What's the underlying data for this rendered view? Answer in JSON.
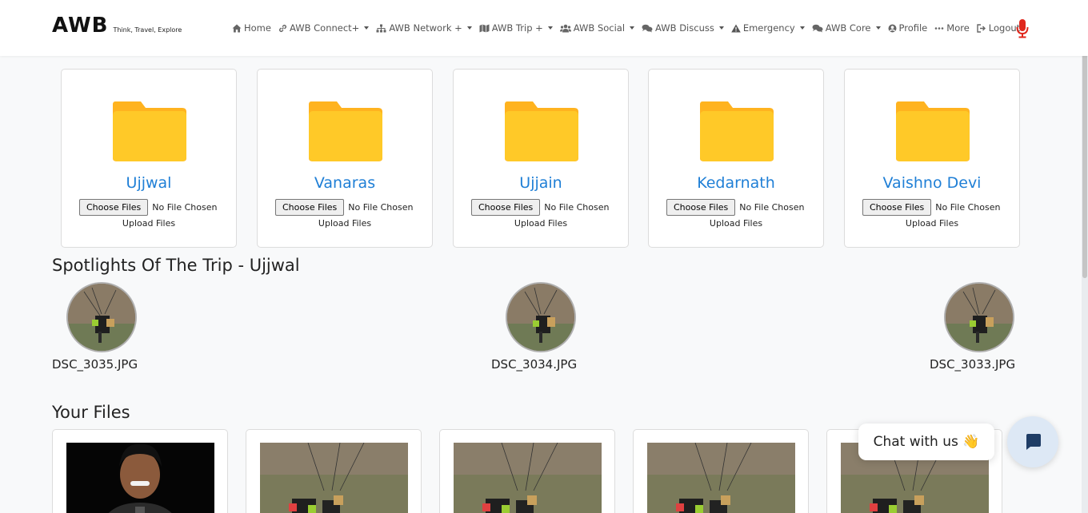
{
  "brand": {
    "name": "AWB",
    "tagline": "Think, Travel, Explore"
  },
  "nav": [
    {
      "label": "Home",
      "icon": "home-icon",
      "dropdown": false
    },
    {
      "label": "AWB Connect+",
      "icon": "link-icon",
      "dropdown": true
    },
    {
      "label": "AWB Network +",
      "icon": "sitemap-icon",
      "dropdown": true
    },
    {
      "label": "AWB Trip +",
      "icon": "map-icon",
      "dropdown": true
    },
    {
      "label": "AWB Social",
      "icon": "users-icon",
      "dropdown": true
    },
    {
      "label": "AWB Discuss",
      "icon": "comments-icon",
      "dropdown": true
    },
    {
      "label": "Emergency",
      "icon": "warning-icon",
      "dropdown": true
    },
    {
      "label": "AWB Core",
      "icon": "comments-icon",
      "dropdown": true
    },
    {
      "label": "Profile",
      "icon": "user-circle-icon",
      "dropdown": false
    },
    {
      "label": "More",
      "icon": "ellipsis-icon",
      "dropdown": false
    },
    {
      "label": "Logout",
      "icon": "logout-icon",
      "dropdown": false
    }
  ],
  "folders": [
    {
      "name": "Ujjwal",
      "button": "Choose Files",
      "status": "No File Chosen",
      "upload": "Upload Files"
    },
    {
      "name": "Vanaras",
      "button": "Choose Files",
      "status": "No File Chosen",
      "upload": "Upload Files"
    },
    {
      "name": "Ujjain",
      "button": "Choose Files",
      "status": "No File Chosen",
      "upload": "Upload Files"
    },
    {
      "name": "Kedarnath",
      "button": "Choose Files",
      "status": "No File Chosen",
      "upload": "Upload Files"
    },
    {
      "name": "Vaishno Devi",
      "button": "Choose Files",
      "status": "No File Chosen",
      "upload": "Upload Files"
    }
  ],
  "spotlights": {
    "title": "Spotlights Of The Trip - Ujjwal",
    "items": [
      {
        "name": "DSC_3035.JPG"
      },
      {
        "name": "DSC_3034.JPG"
      },
      {
        "name": "DSC_3033.JPG"
      }
    ]
  },
  "files": {
    "title": "Your Files"
  },
  "chat": {
    "label": "Chat with us 👋"
  },
  "colors": {
    "accent": "#1f7fd6",
    "folder": "#ffc928",
    "mic": "#e0261b"
  }
}
